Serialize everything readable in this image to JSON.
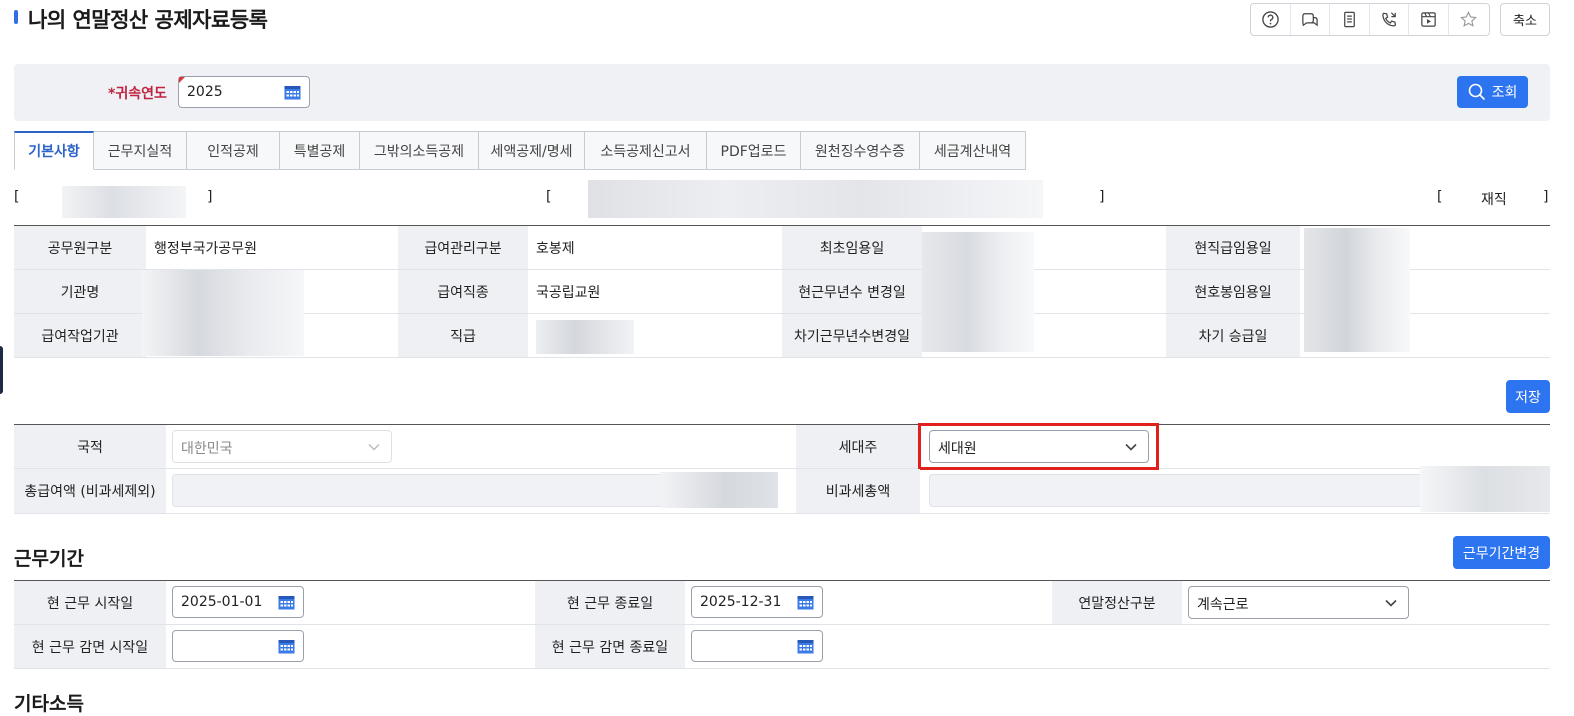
{
  "header": {
    "title": "나의 연말정산 공제자료등록",
    "tools": [
      {
        "icon": "help-icon"
      },
      {
        "icon": "chat-icon"
      },
      {
        "icon": "document-icon"
      },
      {
        "icon": "phone-icon"
      },
      {
        "icon": "video-icon"
      },
      {
        "icon": "star-icon"
      }
    ],
    "shrink_label": "축소"
  },
  "search": {
    "year_label": "*귀속연도",
    "year_value": "2025",
    "search_label": "조회"
  },
  "tabs": [
    {
      "label": "기본사항",
      "active": true
    },
    {
      "label": "근무지실적"
    },
    {
      "label": "인적공제"
    },
    {
      "label": "특별공제"
    },
    {
      "label": "그밖의소득공제"
    },
    {
      "label": "세액공제/명세"
    },
    {
      "label": "소득공제신고서"
    },
    {
      "label": "PDF업로드"
    },
    {
      "label": "원천징수영수증"
    },
    {
      "label": "세금계산내역"
    }
  ],
  "summary_line": {
    "status": "재직"
  },
  "info_table": {
    "rows": [
      {
        "h1": "공무원구분",
        "v1": "행정부국가공무원",
        "h2": "급여관리구분",
        "v2": "호봉제",
        "h3": "최초임용일",
        "h4": "현직급임용일"
      },
      {
        "h1": "기관명",
        "v1": "",
        "h2": "급여직종",
        "v2": "국공립교원",
        "h3": "현근무년수 변경일",
        "h4": "현호봉임용일"
      },
      {
        "h1": "급여작업기관",
        "v1": "",
        "h2": "직급",
        "v2": "",
        "h3": "차기근무년수변경일",
        "h4": "차기 승급일"
      }
    ]
  },
  "save_label": "저장",
  "household": {
    "nationality_label": "국적",
    "nationality_value": "대한민국",
    "head_label": "세대주",
    "head_value": "세대원",
    "total_pay_label": "총급여액 (비과세제외)",
    "nontax_label": "비과세총액"
  },
  "work_period": {
    "title": "근무기간",
    "change_label": "근무기간변경",
    "start_label": "현 근무 시작일",
    "start_value": "2025-01-01",
    "end_label": "현 근무 종료일",
    "end_value": "2025-12-31",
    "type_label": "연말정산구분",
    "type_value": "계속근로",
    "reduce_start_label": "현 근무 감면 시작일",
    "reduce_start_value": "",
    "reduce_end_label": "현 근무 감면 종료일",
    "reduce_end_value": ""
  },
  "next_section_title": "기타소득"
}
